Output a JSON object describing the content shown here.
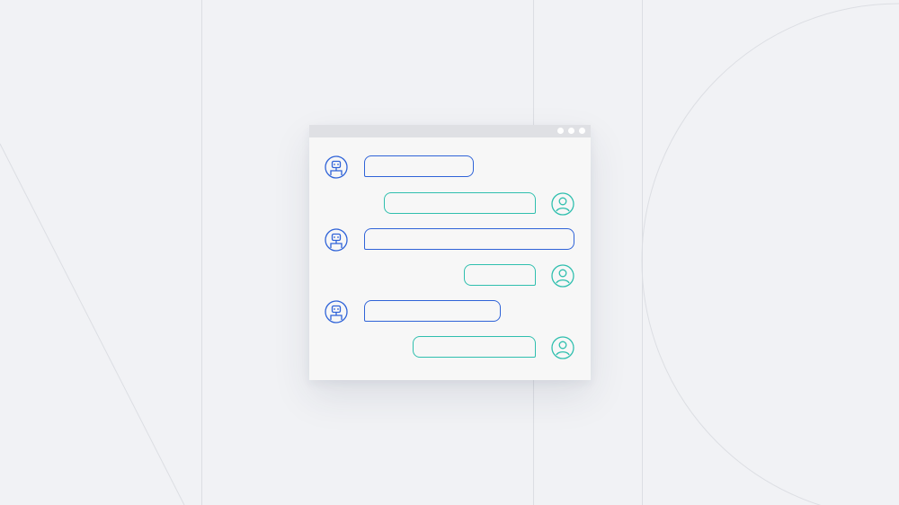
{
  "window": {
    "titlebar_buttons": [
      "dot",
      "dot",
      "dot"
    ]
  },
  "colors": {
    "background": "#f1f2f5",
    "window": "#f7f7f7",
    "titlebar": "#dfe0e4",
    "bot": "#2f63d8",
    "user": "#2fbfae",
    "lines": "#dcdee3"
  },
  "conversation": [
    {
      "sender": "bot",
      "icon": "robot-icon"
    },
    {
      "sender": "user",
      "icon": "user-icon"
    },
    {
      "sender": "bot",
      "icon": "robot-icon"
    },
    {
      "sender": "user",
      "icon": "user-icon"
    },
    {
      "sender": "bot",
      "icon": "robot-icon"
    },
    {
      "sender": "user",
      "icon": "user-icon"
    }
  ]
}
